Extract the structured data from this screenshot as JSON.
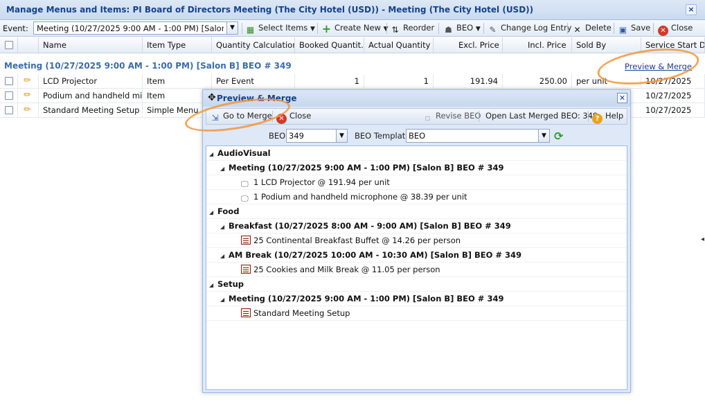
{
  "window": {
    "title": "Manage Menus and Items: PI Board of Directors Meeting (The City Hotel (USD)) - Meeting (The City Hotel (USD))"
  },
  "toolbar": {
    "event_label": "Event:",
    "event_value": "Meeting (10/27/2025 9:00 AM - 1:00 PM) [Salon B] BEO # 349",
    "select_items": "Select Items",
    "create_new": "Create New",
    "reorder": "Reorder",
    "beo": "BEO",
    "change_log": "Change Log Entry",
    "delete": "Delete",
    "save": "Save",
    "close": "Close"
  },
  "grid": {
    "columns": [
      "Name",
      "Item Type",
      "Quantity Calculation",
      "Booked Quantit...",
      "Actual Quantity",
      "Excl. Price",
      "Incl. Price",
      "Sold By",
      "Service Start D..."
    ],
    "group_label": "Meeting (10/27/2025 9:00 AM - 1:00 PM) [Salon B] BEO # 349",
    "preview_merge_link": "Preview & Merge",
    "rows": [
      {
        "name": "LCD Projector",
        "item_type": "Item",
        "qty_calc": "Per Event",
        "booked": "1",
        "actual": "1",
        "excl": "191.94",
        "incl": "250.00",
        "sold_by": "per unit",
        "start": "10/27/2025"
      },
      {
        "name": "Podium and handheld mic...",
        "item_type": "Item",
        "qty_calc": "",
        "booked": "",
        "actual": "",
        "excl": "",
        "incl": "",
        "sold_by": "",
        "start": "10/27/2025"
      },
      {
        "name": "Standard Meeting Setup",
        "item_type": "Simple Menu",
        "qty_calc": "",
        "booked": "",
        "actual": "",
        "excl": "",
        "incl": "",
        "sold_by": "",
        "start": "10/27/2025"
      }
    ]
  },
  "dialog": {
    "title": "Preview & Merge",
    "go_to_merge": "Go to Merge",
    "close": "Close",
    "revise_beo": "Revise BEO",
    "open_last": "Open Last Merged BEO: 349",
    "help": "Help",
    "beo_label": "BEO",
    "beo_value": "349",
    "template_label": "BEO Template",
    "template_value": "BEO",
    "tree": {
      "cat1": "AudioVisual",
      "cat1_ev1": "Meeting (10/27/2025 9:00 AM - 1:00 PM) [Salon B] BEO # 349",
      "cat1_ev1_i1": "1 LCD Projector @ 191.94 per unit",
      "cat1_ev1_i2": "1 Podium and handheld microphone @ 38.39 per unit",
      "cat2": "Food",
      "cat2_ev1": "Breakfast (10/27/2025 8:00 AM - 9:00 AM) [Salon B] BEO # 349",
      "cat2_ev1_i1": "25 Continental Breakfast Buffet @ 14.26 per person",
      "cat2_ev2": "AM Break (10/27/2025 10:00 AM - 10:30 AM) [Salon B] BEO # 349",
      "cat2_ev2_i1": "25 Cookies and Milk Break @ 11.05 per person",
      "cat3": "Setup",
      "cat3_ev1": "Meeting (10/27/2025 9:00 AM - 1:00 PM) [Salon B] BEO # 349",
      "cat3_ev1_i1": "Standard Meeting Setup"
    }
  }
}
